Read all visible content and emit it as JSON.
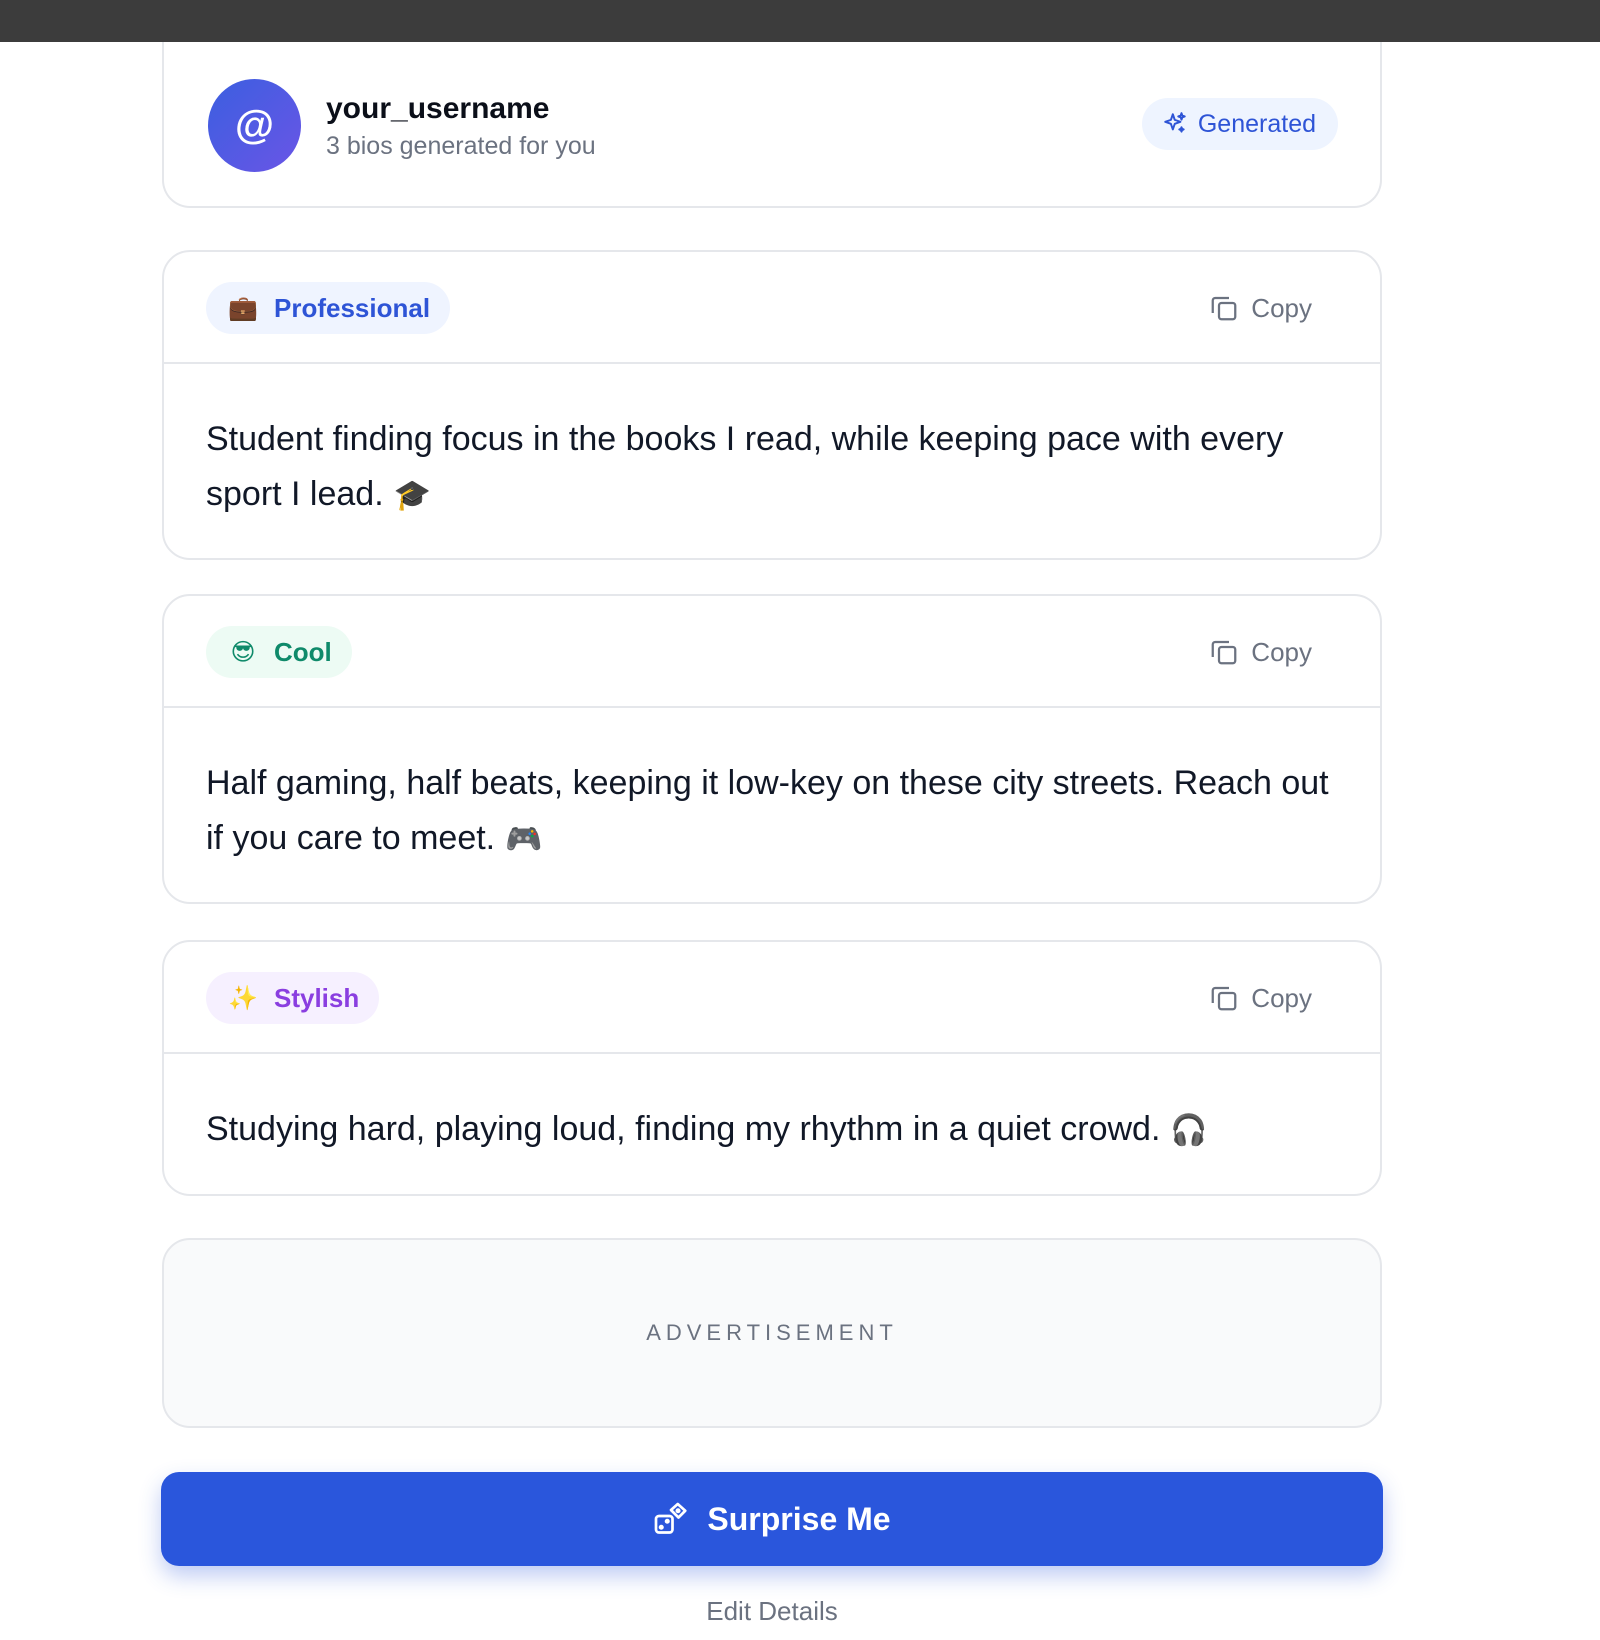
{
  "header": {
    "avatar_symbol": "@",
    "username": "your_username",
    "subtitle": "3 bios generated for you",
    "badge_label": "Generated"
  },
  "bios": [
    {
      "tag": "Professional",
      "tag_emoji": "💼",
      "copy_label": "Copy",
      "text": "Student finding focus in the books I read, while keeping pace with every sport I lead.",
      "emoji": "🎓"
    },
    {
      "tag": "Cool",
      "tag_emoji": "😎",
      "copy_label": "Copy",
      "text": "Half gaming, half beats, keeping it low-key on these city streets. Reach out if you care to meet.",
      "emoji": "🎮"
    },
    {
      "tag": "Stylish",
      "tag_emoji": "✨",
      "copy_label": "Copy",
      "text": "Studying hard, playing loud, finding my rhythm in a quiet crowd.",
      "emoji": "🎧"
    }
  ],
  "ad": {
    "label": "ADVERTISEMENT"
  },
  "actions": {
    "surprise_label": "Surprise Me",
    "edit_label": "Edit Details"
  },
  "colors": {
    "primary": "#2a56dc",
    "professional": "#2e54d6",
    "cool": "#0f8a6a",
    "stylish": "#8a3ee0"
  },
  "icons": {
    "badge": "sparkles-icon",
    "copy": "copy-icon",
    "surprise": "dice-icon"
  }
}
